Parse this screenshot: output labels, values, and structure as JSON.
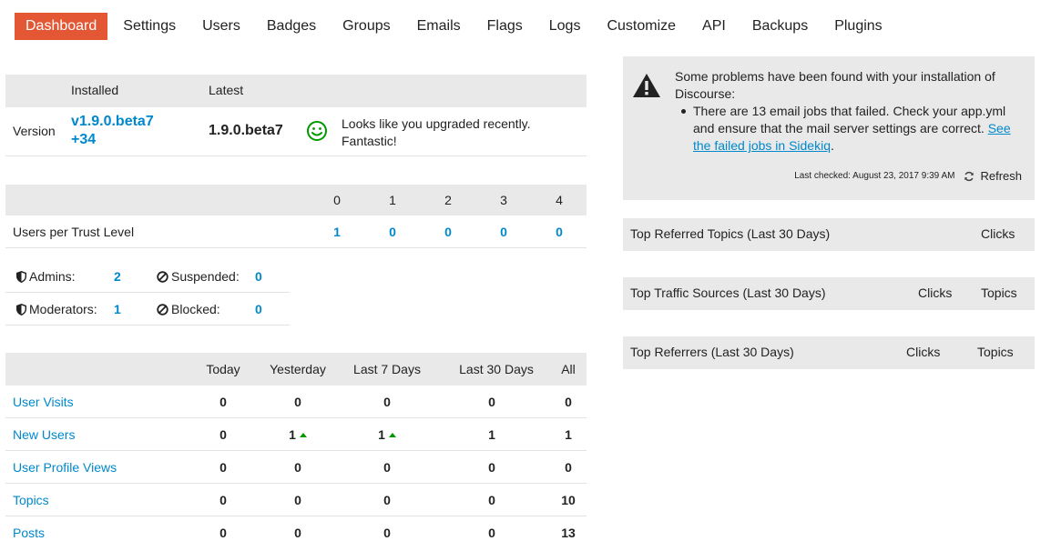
{
  "nav": {
    "items": [
      "Dashboard",
      "Settings",
      "Users",
      "Badges",
      "Groups",
      "Emails",
      "Flags",
      "Logs",
      "Customize",
      "API",
      "Backups",
      "Plugins"
    ]
  },
  "version": {
    "installed_header": "Installed",
    "latest_header": "Latest",
    "label": "Version",
    "installed_line1": "v1.9.0.beta7",
    "installed_line2": "+34",
    "latest": "1.9.0.beta7",
    "message_line1": "Looks like you upgraded recently.",
    "message_line2": "Fantastic!",
    "status_icon": "smile-icon",
    "status_color": "#009900"
  },
  "trust": {
    "levels": [
      "0",
      "1",
      "2",
      "3",
      "4"
    ],
    "label": "Users per Trust Level",
    "values": [
      "1",
      "0",
      "0",
      "0",
      "0"
    ]
  },
  "staff": {
    "admins_label": "Admins:",
    "admins": "2",
    "suspended_label": "Suspended:",
    "suspended": "0",
    "moderators_label": "Moderators:",
    "moderators": "1",
    "blocked_label": "Blocked:",
    "blocked": "0"
  },
  "stats": {
    "headers": [
      "Today",
      "Yesterday",
      "Last 7 Days",
      "Last 30 Days",
      "All"
    ],
    "rows": [
      {
        "label": "User Visits",
        "values": [
          "0",
          "0",
          "0",
          "0",
          "0"
        ]
      },
      {
        "label": "New Users",
        "values": [
          "0",
          "1",
          "1",
          "1",
          "1"
        ]
      },
      {
        "label": "User Profile Views",
        "values": [
          "0",
          "0",
          "0",
          "0",
          "0"
        ]
      },
      {
        "label": "Topics",
        "values": [
          "0",
          "0",
          "0",
          "0",
          "10"
        ]
      },
      {
        "label": "Posts",
        "values": [
          "0",
          "0",
          "0",
          "0",
          "13"
        ]
      }
    ],
    "trend_color": "#009900"
  },
  "warning": {
    "intro_line1": "Some problems have been found with your installation of",
    "intro_line2": "Discourse:",
    "problem_text": "There are 13 email jobs that failed. Check your app.yml and ensure that the mail server settings are correct.",
    "problem_link": "See the failed jobs in Sidekiq",
    "problem_end": ".",
    "last_checked": "Last checked: August 23, 2017 9:39 AM",
    "refresh": "Refresh"
  },
  "referred_topics": {
    "title": "Top Referred Topics (Last 30 Days)",
    "col1": "Clicks"
  },
  "traffic_sources": {
    "title": "Top Traffic Sources (Last 30 Days)",
    "col1": "Clicks",
    "col2": "Topics"
  },
  "referrers": {
    "title": "Top Referrers (Last 30 Days)",
    "col1": "Clicks",
    "col2": "Topics"
  },
  "colors": {
    "accent": "#e45735",
    "link": "#0088cc",
    "panel": "#e9e9e9"
  }
}
